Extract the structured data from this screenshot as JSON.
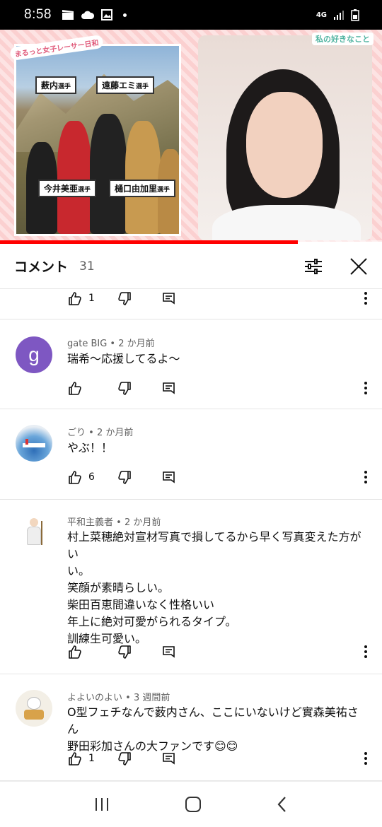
{
  "status_bar": {
    "time": "8:58",
    "network": "4G"
  },
  "video": {
    "badge_text": "まるっと女子レーサー日和",
    "corner_label": "私の好きなこと",
    "name_tags": [
      {
        "name": "薮内",
        "suffix": "選手"
      },
      {
        "name": "遠藤エミ",
        "suffix": "選手"
      },
      {
        "name": "今井美亜",
        "suffix": "選手"
      },
      {
        "name": "樋口由加里",
        "suffix": "選手"
      }
    ],
    "progress": 0.78
  },
  "comments_header": {
    "title": "コメント",
    "count": "31"
  },
  "top_row": {
    "likes": "1"
  },
  "comments": [
    {
      "author": "gate BIG",
      "age": "2 か月前",
      "avatar_letter": "g",
      "avatar_color": "#7e57c2",
      "lines": [
        "瑞希〜応援してるよ〜"
      ],
      "likes": ""
    },
    {
      "author": "ごり",
      "age": "2 か月前",
      "avatar_letter": "",
      "lines": [
        "やぶ！！"
      ],
      "likes": "6"
    },
    {
      "author": "平和主義者",
      "age": "2 か月前",
      "avatar_letter": "",
      "lines": [
        "村上菜穂絶対宣材写真で損してるから早く写真変えた方がい",
        "い。",
        "笑顔が素晴らしい。",
        "柴田百恵間違いなく性格いい",
        "年上に絶対可愛がられるタイプ。",
        "訓練生可愛い。"
      ],
      "likes": ""
    },
    {
      "author": "よよいのよい",
      "age": "3 週間前",
      "avatar_letter": "",
      "lines": [
        "O型フェチなんで薮内さん、ここにいないけど實森美祐さん",
        "野田彩加さんの大ファンです😊😊"
      ],
      "likes": "1"
    }
  ],
  "separator": " • "
}
